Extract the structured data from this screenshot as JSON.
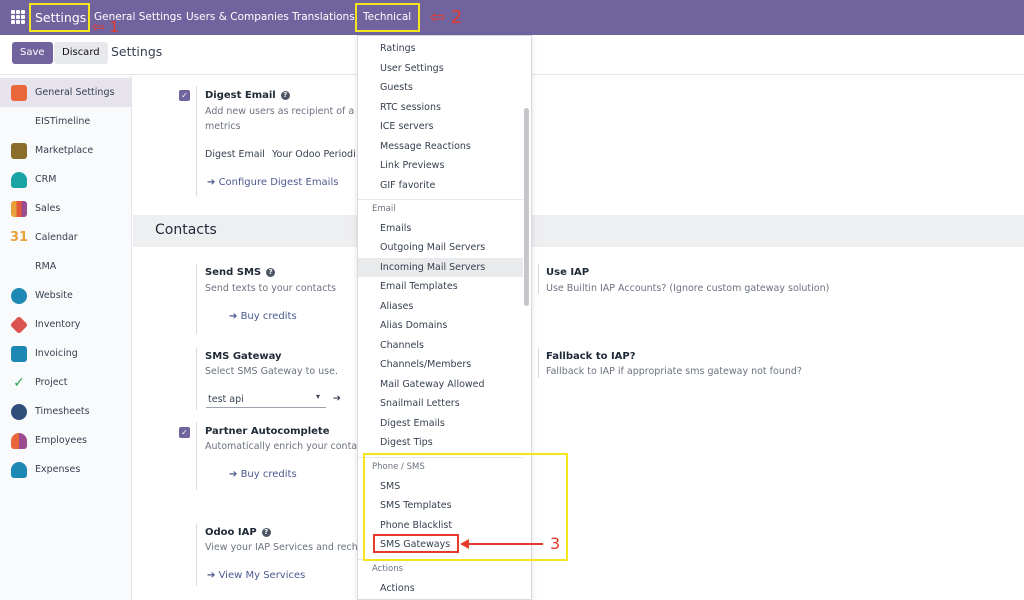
{
  "navbar": {
    "brand": "Settings",
    "menus": [
      "General Settings",
      "Users & Companies",
      "Translations",
      "Technical"
    ]
  },
  "annotations": {
    "step1": "⇦ 1",
    "step2": "⇦ 2",
    "step3": "3"
  },
  "control_panel": {
    "save_label": "Save",
    "discard_label": "Discard",
    "breadcrumb": "Settings"
  },
  "sidebar": {
    "items": [
      {
        "label": "General Settings",
        "icon": "settings-icon",
        "color": "#e8663a"
      },
      {
        "label": "EISTimeline",
        "icon": "",
        "color": ""
      },
      {
        "label": "Marketplace",
        "icon": "marketplace-icon",
        "color": "#8a6d2b"
      },
      {
        "label": "CRM",
        "icon": "crm-icon",
        "color": "#1aa3a3"
      },
      {
        "label": "Sales",
        "icon": "sales-icon",
        "color": "#e25a3a"
      },
      {
        "label": "Calendar",
        "icon": "calendar-icon",
        "color": "#e8a13a"
      },
      {
        "label": "RMA",
        "icon": "",
        "color": ""
      },
      {
        "label": "Website",
        "icon": "website-icon",
        "color": "#1e88b5"
      },
      {
        "label": "Inventory",
        "icon": "inventory-icon",
        "color": "#d9534f"
      },
      {
        "label": "Invoicing",
        "icon": "invoicing-icon",
        "color": "#1e88b5"
      },
      {
        "label": "Project",
        "icon": "project-icon",
        "color": "#2ea35b"
      },
      {
        "label": "Timesheets",
        "icon": "timesheets-icon",
        "color": "#2f4f7a"
      },
      {
        "label": "Employees",
        "icon": "employees-icon",
        "color": "#e8663a"
      },
      {
        "label": "Expenses",
        "icon": "expenses-icon",
        "color": "#1e88b5"
      }
    ],
    "calendar_glyph": "31"
  },
  "main": {
    "digest": {
      "title": "Digest Email",
      "desc_line1": "Add new users as recipient of a p",
      "desc_line2": "metrics",
      "field_label": "Digest Email",
      "field_value": "Your Odoo Periodi",
      "link": "Configure Digest Emails"
    },
    "section_title": "Contacts",
    "send_sms": {
      "title": "Send SMS",
      "desc": "Send texts to your contacts",
      "link": "Buy credits"
    },
    "use_iap": {
      "title": "Use IAP",
      "desc": "Use Builtin IAP Accounts? (Ignore custom gateway solution)"
    },
    "sms_gateway": {
      "title": "SMS Gateway",
      "desc": "Select SMS Gateway to use.",
      "value": "test api"
    },
    "fallback": {
      "title": "Fallback to IAP?",
      "desc": "Fallback to IAP if appropriate sms gateway not found?"
    },
    "partner": {
      "title": "Partner Autocomplete",
      "desc": "Automatically enrich your contac",
      "link": "Buy credits"
    },
    "odoo_iap": {
      "title": "Odoo IAP",
      "desc": "View your IAP Services and rech",
      "link": "View My Services"
    }
  },
  "dropdown": {
    "group_items_top": [
      "Ratings",
      "User Settings",
      "Guests",
      "RTC sessions",
      "ICE servers",
      "Message Reactions",
      "Link Previews",
      "GIF favorite"
    ],
    "email_header": "Email",
    "email_items": [
      "Emails",
      "Outgoing Mail Servers",
      "Incoming Mail Servers",
      "Email Templates",
      "Aliases",
      "Alias Domains",
      "Channels",
      "Channels/Members",
      "Mail Gateway Allowed",
      "Snailmail Letters",
      "Digest Emails",
      "Digest Tips"
    ],
    "phone_header": "Phone / SMS",
    "phone_items": [
      "SMS",
      "SMS Templates",
      "Phone Blacklist",
      "SMS Gateways"
    ],
    "actions_header": "Actions",
    "actions_items": [
      "Actions"
    ]
  },
  "colors": {
    "brand": "#71639e",
    "highlight": "#f5e51b",
    "annotation": "#e53a2a"
  }
}
